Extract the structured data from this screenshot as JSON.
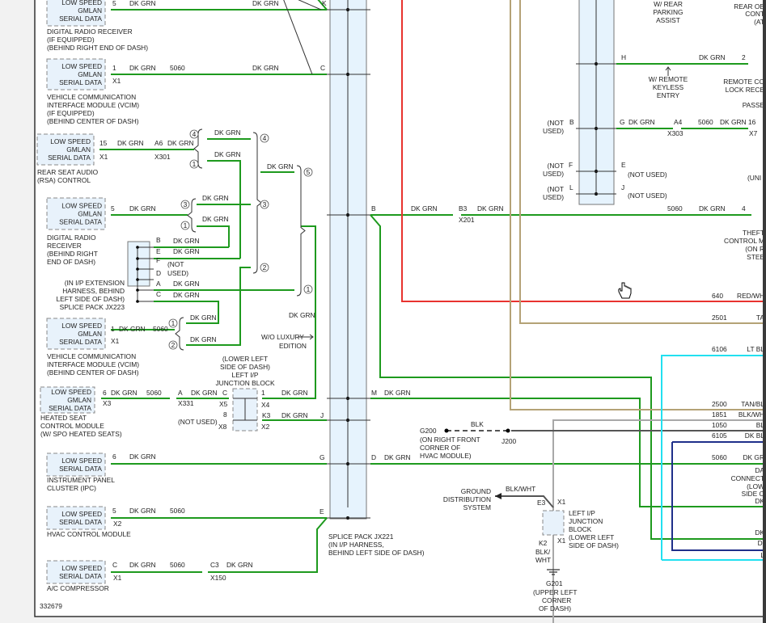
{
  "diagram_id": "332679",
  "colors": {
    "dk_grn": "#1e9a1e",
    "red_wht": "#e8332f",
    "tan": "#b4a276",
    "blk_wht": "#a8a8a8",
    "blk": "#555555",
    "lt_blu": "#22e0f0",
    "dk_blu": "#1f2f8a",
    "splice": "#e6f3fd"
  },
  "modules": [
    {
      "box": [
        "LOW SPEED",
        "GMLAN",
        "SERIAL DATA"
      ],
      "name": [
        "DIGITAL RADIO RECEIVER",
        "(IF EQUIPPED)",
        "(BEHIND RIGHT END OF DASH)"
      ]
    },
    {
      "box": [
        "LOW SPEED",
        "GMLAN",
        "SERIAL DATA"
      ],
      "name": [
        "VEHICLE COMMUNICATION",
        "INTERFACE MODULE (VCIM)",
        "(IF EQUIPPED)",
        "(BEHIND CENTER OF DASH)"
      ]
    },
    {
      "box": [
        "LOW SPEED",
        "GMLAN",
        "SERIAL DATA"
      ],
      "name": [
        "REAR SEAT AUDIO",
        "(RSA) CONTROL"
      ]
    },
    {
      "box": [
        "LOW SPEED",
        "GMLAN",
        "SERIAL DATA"
      ],
      "name": [
        "DIGITAL RADIO",
        "RECEIVER",
        "(BEHIND RIGHT",
        "END OF DASH)"
      ]
    },
    {
      "box": [
        "LOW SPEED",
        "GMLAN",
        "SERIAL DATA"
      ],
      "name": [
        "VEHICLE COMMUNICATION",
        "INTERFACE MODULE (VCIM)",
        "(BEHIND CENTER OF DASH)"
      ]
    },
    {
      "box": [
        "LOW SPEED",
        "GMLAN",
        "SERIAL DATA"
      ],
      "name": [
        "HEATED SEAT",
        "CONTROL MODULE",
        "(W/ SPO HEATED SEATS)"
      ]
    },
    {
      "box": [
        "LOW SPEED",
        "SERIAL DATA"
      ],
      "name": [
        "INSTRUMENT PANEL",
        "CLUSTER (IPC)"
      ]
    },
    {
      "box": [
        "LOW SPEED",
        "SERIAL DATA"
      ],
      "name": [
        "HVAC CONTROL MODULE"
      ]
    },
    {
      "box": [
        "LOW SPEED",
        "SERIAL DATA"
      ],
      "name": [
        "A/C COMPRESSOR"
      ]
    }
  ],
  "wire": {
    "dk_grn": "DK GRN",
    "circuit": "5060",
    "blk": "BLK",
    "blk_wht": "BLK/WHT",
    "blk_wht_split": [
      "BLK/",
      "WHT"
    ]
  },
  "pins": {
    "drr1": "5",
    "vcim1": "1",
    "rsa": "15",
    "rsa_conn": "A6",
    "drr2": "5",
    "vcim2": "1",
    "hscm": "6",
    "hscm_conn": "A",
    "jb_c": "C",
    "jb_1": "1",
    "jb_8": "8",
    "jb_k3": "K3",
    "ipc": "6",
    "hvac": "5",
    "ac": "C",
    "ac_conn": "C3",
    "sp_k": "K",
    "sp_c": "C",
    "sp_j": "J",
    "sp_g": "G",
    "sp_e": "E",
    "sp_b": "B",
    "sp_m": "M",
    "sp_d": "D",
    "b3": "B3",
    "jx223": [
      "B",
      "E",
      "F",
      "D",
      "A",
      "C"
    ],
    "r_h": "H",
    "r_2": "2",
    "r_g": "G",
    "r_a4": "A4",
    "r_16": "16",
    "r_b": "B",
    "r_f": "F",
    "r_e": "E",
    "r_l": "L",
    "r_j": "J",
    "r_4": "4",
    "e3": "E3",
    "k2": "K2"
  },
  "connectors": {
    "x1": "X1",
    "x2": "X2",
    "x3": "X3",
    "x4": "X4",
    "x5": "X5",
    "x7": "X7",
    "x8": "X8",
    "x150": "X150",
    "x201": "X201",
    "x301": "X301",
    "x303": "X303",
    "x331": "X331"
  },
  "splice_circles": [
    "4",
    "1",
    "3",
    "1",
    "4",
    "3",
    "2",
    "5",
    "1",
    "1",
    "2"
  ],
  "not_used": [
    "(NOT",
    "USED)",
    "(NOT USED)"
  ],
  "splice_jx223": [
    "(IN I/P EXTENSION",
    "HARNESS, BEHIND",
    "LEFT SIDE OF DASH)",
    "SPLICE PACK JX223"
  ],
  "splice_jx221": [
    "SPLICE PACK JX221",
    "(IN I/P HARNESS,",
    "BEHIND LEFT SIDE OF DASH)"
  ],
  "left_jb": [
    "(LOWER LEFT",
    "SIDE OF DASH)",
    "LEFT I/P",
    "JUNCTION BLOCK"
  ],
  "wo_luxury": [
    "W/O LUXURY",
    "EDITION"
  ],
  "rear_parking": [
    "W/ REAR",
    "PARKING",
    "ASSIST"
  ],
  "remote_keyless": [
    "W/ REMOTE",
    "KEYLESS",
    "ENTRY"
  ],
  "rear_obj": [
    "REAR OB",
    "CONT",
    "(AT"
  ],
  "remote_lock": [
    "REMOTE CO",
    "LOCK RECE",
    "PASSE"
  ],
  "theft": [
    "THEFT",
    "CONTROL M",
    "(ON R",
    "STEE"
  ],
  "uni": "(UNI",
  "g200": [
    "G200",
    "(ON RIGHT FRONT",
    "CORNER OF",
    "HVAC MODULE)"
  ],
  "j200": "J200",
  "ground_dist": [
    "GROUND",
    "DISTRIBUTION",
    "SYSTEM"
  ],
  "left_jb2": [
    "LEFT I/P",
    "JUNCTION",
    "BLOCK",
    "(LOWER LEFT",
    "SIDE OF DASH)"
  ],
  "g201": [
    "G201",
    "(UPPER LEFT",
    "CORNER",
    "OF DASH)"
  ],
  "right_circuits": [
    {
      "num": "640",
      "color": "RED/WH"
    },
    {
      "num": "2501",
      "color": "TA"
    },
    {
      "num": "6106",
      "color": "LT BL"
    },
    {
      "num": "2500",
      "color": "TAN/BL"
    },
    {
      "num": "1851",
      "color": "BLK/WH"
    },
    {
      "num": "1050",
      "color": "BL"
    },
    {
      "num": "6105",
      "color": "DK BL"
    },
    {
      "num": "5060",
      "color": "DK GR"
    }
  ],
  "dash_conn": [
    "DA",
    "CONNECT",
    "(LOW",
    "SIDE O",
    "DK",
    "DK",
    "DI",
    "L"
  ]
}
